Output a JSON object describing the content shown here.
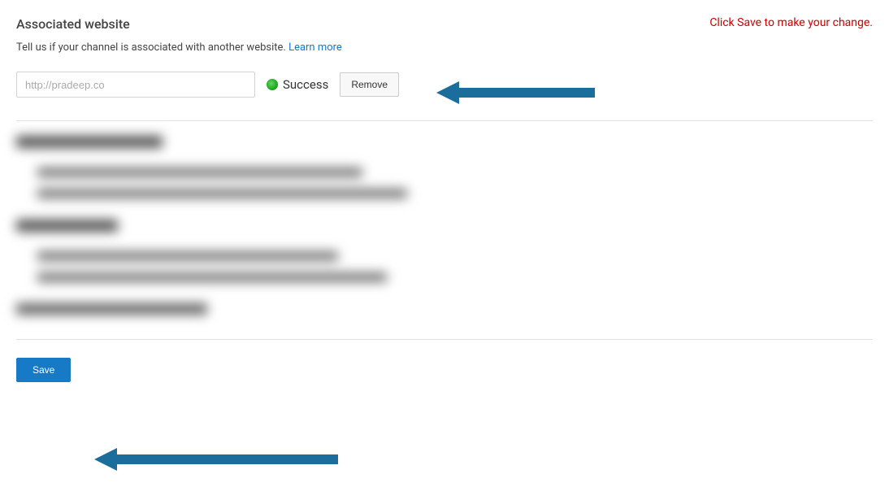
{
  "header": {
    "title": "Associated website",
    "notice": "Click Save to make your change."
  },
  "description": {
    "text": "Tell us if your channel is associated with another website. ",
    "learn_more": "Learn more"
  },
  "website_input": {
    "value": "http://pradeep.co"
  },
  "status": {
    "label": "Success"
  },
  "buttons": {
    "remove": "Remove",
    "save": "Save"
  }
}
